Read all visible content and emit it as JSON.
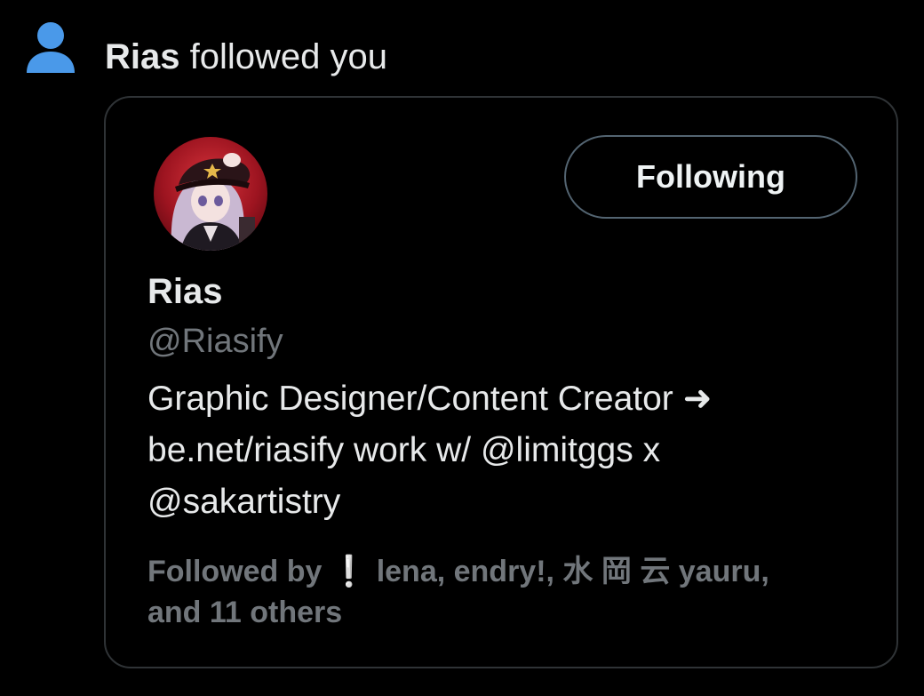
{
  "notification": {
    "actor_name": "Rias",
    "action_text": "followed you",
    "icon": "person-icon",
    "icon_color": "#4a99e9"
  },
  "profile_card": {
    "avatar": "avatar-image",
    "follow_button_label": "Following",
    "display_name": "Rias",
    "handle": "@Riasify",
    "bio_lines": [
      "Graphic Designer/Content Creator ➜",
      "be.net/riasify work w/ @limitggs x",
      "@sakartistry"
    ],
    "followed_by": {
      "prefix": "Followed by",
      "names_line1": "lena, endry!, 水 岡 云 yauru,",
      "names_line2": "and 11 others",
      "emoji": "❕"
    }
  },
  "colors": {
    "background": "#000000",
    "primary_text": "#e7e9ea",
    "secondary_text": "#71767b",
    "border": "#2f3336",
    "accent_blue": "#4a99e9"
  }
}
